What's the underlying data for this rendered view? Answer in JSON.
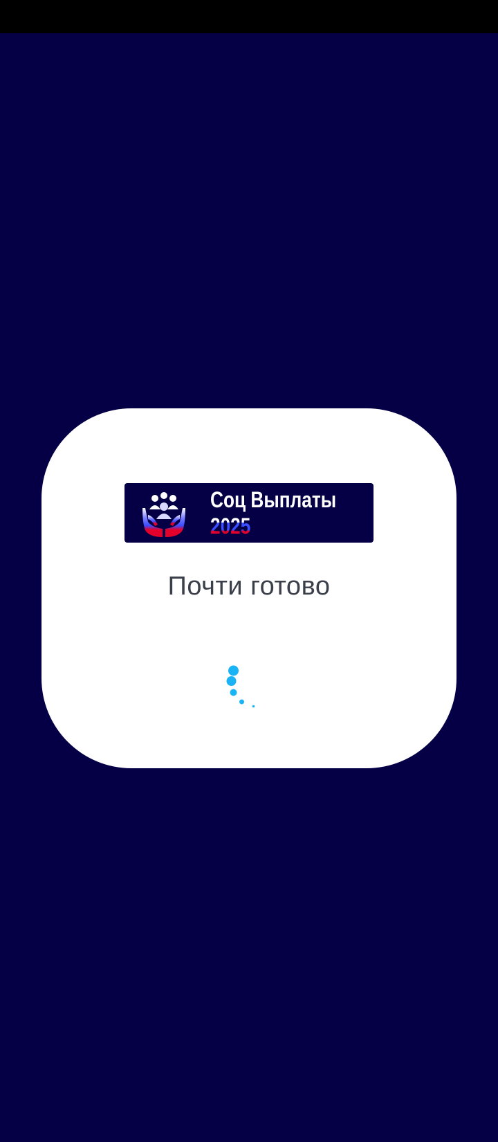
{
  "status_bar": {},
  "logo": {
    "title": "Соц Выплаты",
    "year": "2025",
    "emblem_icon": "people-in-hands-icon"
  },
  "loading": {
    "message": "Почти готово",
    "spinner_icon": "loading-spinner-icon"
  },
  "colors": {
    "background": "#050046",
    "card": "#ffffff",
    "spinner": "#1ab3f5",
    "text": "#3a3f4a",
    "flag_white": "#ffffff",
    "flag_blue": "#3a4dff",
    "flag_red": "#e3002b"
  }
}
